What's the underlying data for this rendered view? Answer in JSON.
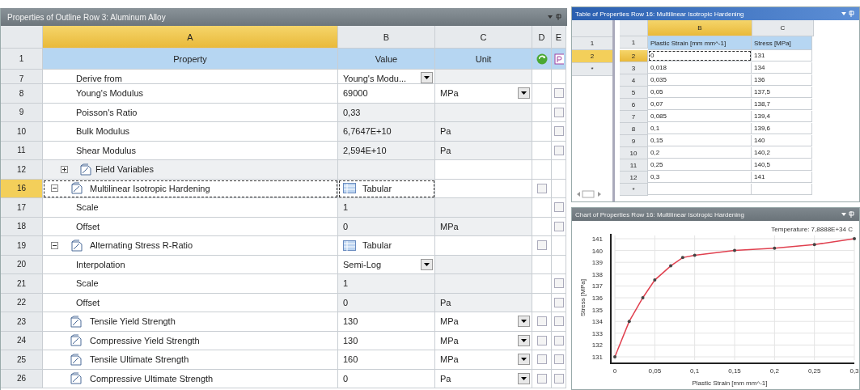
{
  "properties": {
    "title": "Properties of Outline Row 3: Aluminum Alloy",
    "columns": [
      {
        "letter": "A",
        "selected": true
      },
      {
        "letter": "B",
        "selected": false
      },
      {
        "letter": "C",
        "selected": false
      },
      {
        "letter": "D",
        "selected": false
      },
      {
        "letter": "E",
        "selected": false
      }
    ],
    "header": {
      "number": "1",
      "property": "Property",
      "value": "Value",
      "unit": "Unit"
    },
    "rows": [
      {
        "number": "7",
        "kind": "plain",
        "property": "Derive from",
        "value": "Young's Modu...",
        "value_dropdown": true,
        "selected": false
      },
      {
        "number": "8",
        "kind": "plain",
        "property": "Young's Modulus",
        "value": "69000",
        "unit": "MPa",
        "unit_dropdown": true,
        "e_checkbox": {
          "checked": false
        },
        "selected": false
      },
      {
        "number": "9",
        "kind": "plain",
        "property": "Poisson's Ratio",
        "value": "0,33",
        "e_checkbox": {
          "checked": false
        },
        "selected": false
      },
      {
        "number": "10",
        "kind": "plain",
        "property": "Bulk Modulus",
        "value": "6,7647E+10",
        "unit": "Pa",
        "e_checkbox": {
          "checked": false
        },
        "selected": false
      },
      {
        "number": "11",
        "kind": "plain",
        "property": "Shear Modulus",
        "value": "2,594E+10",
        "unit": "Pa",
        "e_checkbox": {
          "checked": false
        },
        "selected": false
      },
      {
        "number": "12",
        "kind": "field_group",
        "property": "Field Variables",
        "expanded": false,
        "selected": false
      },
      {
        "number": "16",
        "kind": "group",
        "property": "Multilinear Isotropic Hardening",
        "value": "Tabular",
        "value_table_icon": true,
        "d_checkbox": {
          "checked": false
        },
        "expanded": true,
        "selected": true,
        "children": [
          {
            "number": "17",
            "kind": "plain",
            "property": "Scale",
            "value": "1",
            "e_checkbox": {
              "checked": false
            },
            "selected": false
          },
          {
            "number": "18",
            "kind": "plain",
            "property": "Offset",
            "value": "0",
            "unit": "MPa",
            "e_checkbox": {
              "checked": false
            },
            "selected": false
          }
        ]
      },
      {
        "number": "19",
        "kind": "group",
        "property": "Alternating Stress R-Ratio",
        "value": "Tabular",
        "value_table_icon": true,
        "d_checkbox": {
          "checked": false
        },
        "expanded": true,
        "selected": false,
        "children": [
          {
            "number": "20",
            "kind": "plain",
            "property": "Interpolation",
            "value": "Semi-Log",
            "value_dropdown": true,
            "selected": false
          },
          {
            "number": "21",
            "kind": "plain",
            "property": "Scale",
            "value": "1",
            "e_checkbox": {
              "checked": false
            },
            "selected": false
          },
          {
            "number": "22",
            "kind": "plain",
            "property": "Offset",
            "value": "0",
            "unit": "Pa",
            "e_checkbox": {
              "checked": false
            },
            "selected": false
          }
        ]
      },
      {
        "number": "23",
        "kind": "param",
        "property": "Tensile Yield Strength",
        "value": "130",
        "unit": "MPa",
        "unit_dropdown": true,
        "d_checkbox": {
          "checked": false
        },
        "e_checkbox": {
          "checked": false
        },
        "selected": false
      },
      {
        "number": "24",
        "kind": "param",
        "property": "Compressive Yield Strength",
        "value": "130",
        "unit": "MPa",
        "unit_dropdown": true,
        "d_checkbox": {
          "checked": false
        },
        "e_checkbox": {
          "checked": false
        },
        "selected": false
      },
      {
        "number": "25",
        "kind": "param",
        "property": "Tensile Ultimate Strength",
        "value": "160",
        "unit": "MPa",
        "unit_dropdown": true,
        "d_checkbox": {
          "checked": false
        },
        "e_checkbox": {
          "checked": false
        },
        "selected": false
      },
      {
        "number": "26",
        "kind": "param",
        "property": "Compressive Ultimate Strength",
        "value": "0",
        "unit": "Pa",
        "unit_dropdown": true,
        "d_checkbox": {
          "checked": false
        },
        "e_checkbox": {
          "checked": false
        },
        "selected": false
      }
    ]
  },
  "table_window": {
    "title": "Table of Properties Row 16: Multilinear Isotropic Hardening",
    "side_rows": [
      {
        "label": "1",
        "selected": false
      },
      {
        "label": "2",
        "selected": true
      },
      {
        "label": "*",
        "selected": false
      }
    ],
    "columns": [
      {
        "letter": "B",
        "selected": true
      },
      {
        "letter": "C",
        "selected": false
      }
    ],
    "header": {
      "number": "1",
      "strain": "Plastic Strain [mm mm^-1]",
      "stress": "Stress [MPa]"
    },
    "rows": [
      {
        "number": "2",
        "strain": "0",
        "stress": "131",
        "selected": true
      },
      {
        "number": "3",
        "strain": "0,018",
        "stress": "134",
        "selected": false
      },
      {
        "number": "4",
        "strain": "0,035",
        "stress": "136",
        "selected": false
      },
      {
        "number": "5",
        "strain": "0,05",
        "stress": "137,5",
        "selected": false
      },
      {
        "number": "6",
        "strain": "0,07",
        "stress": "138,7",
        "selected": false
      },
      {
        "number": "7",
        "strain": "0,085",
        "stress": "139,4",
        "selected": false
      },
      {
        "number": "8",
        "strain": "0,1",
        "stress": "139,6",
        "selected": false
      },
      {
        "number": "9",
        "strain": "0,15",
        "stress": "140",
        "selected": false
      },
      {
        "number": "10",
        "strain": "0,2",
        "stress": "140,2",
        "selected": false
      },
      {
        "number": "11",
        "strain": "0,25",
        "stress": "140,5",
        "selected": false
      },
      {
        "number": "12",
        "strain": "0,3",
        "stress": "141",
        "selected": false
      }
    ],
    "new_row": "*"
  },
  "chart_window": {
    "title": "Chart of Properties Row 16: Multilinear Isotropic Hardening",
    "chart_data": {
      "type": "line",
      "grid": true,
      "xlabel": "Plastic Strain [mm mm^-1]",
      "ylabel": "Stress [MPa]",
      "x": [
        0,
        0.018,
        0.035,
        0.05,
        0.07,
        0.085,
        0.1,
        0.15,
        0.2,
        0.25,
        0.3
      ],
      "series": [
        {
          "name": "Temperature: 7,8888E+34 C",
          "color": "#e0404f",
          "values": [
            131,
            134,
            136,
            137.5,
            138.7,
            139.4,
            139.6,
            140,
            140.2,
            140.5,
            141
          ]
        }
      ],
      "xlim": [
        0,
        0.3
      ],
      "ylim": [
        131,
        141
      ],
      "xticks": [
        {
          "value": 0,
          "label": "0"
        },
        {
          "value": 0.05,
          "label": "0,05"
        },
        {
          "value": 0.1,
          "label": "0,1"
        },
        {
          "value": 0.15,
          "label": "0,15"
        },
        {
          "value": 0.2,
          "label": "0,2"
        },
        {
          "value": 0.25,
          "label": "0,25"
        },
        {
          "value": 0.3,
          "label": "0,3"
        }
      ],
      "yticks": [
        131,
        132,
        133,
        134,
        135,
        136,
        137,
        138,
        139,
        140,
        141
      ]
    }
  }
}
